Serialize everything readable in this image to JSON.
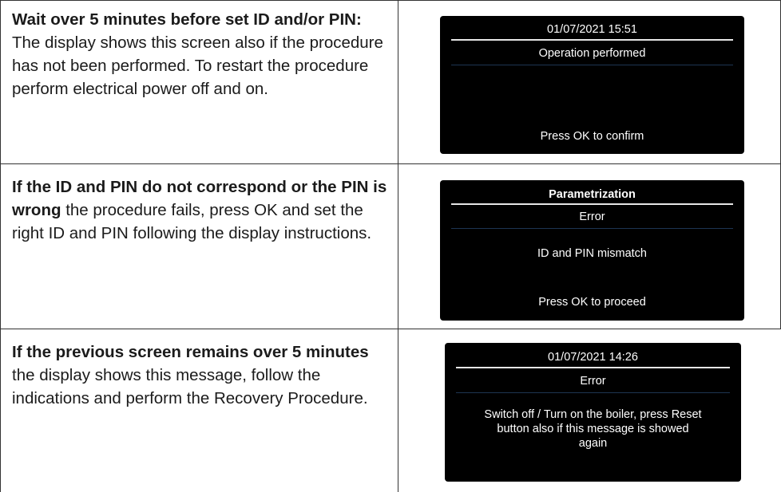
{
  "rows": [
    {
      "bold": "Wait over 5 minutes before set ID and/or PIN:",
      "text": "The display shows this screen also if the procedure has not been performed. To restart the procedure perform electrical power off and on.",
      "screen": {
        "header": "01/07/2021 15:51",
        "subtitle": "Operation performed",
        "message": "",
        "footer": "Press OK to confirm"
      }
    },
    {
      "bold": "If the ID and PIN do not correspond or the PIN is wrong",
      "text": " the procedure fails, press OK and set the right ID and PIN following the display instructions.",
      "screen": {
        "header": "Parametrization",
        "subtitle": "Error",
        "message": "ID and PIN mismatch",
        "footer": "Press OK to proceed"
      }
    },
    {
      "bold": "If the previous screen remains over 5 minutes",
      "text": " the display shows this message, follow the indications and perform the Recovery Procedure.",
      "screen": {
        "header": "01/07/2021 14:26",
        "subtitle": "Error",
        "message": "Switch off / Turn on the boiler, press Reset button also if this message is showed again",
        "footer": ""
      }
    }
  ]
}
